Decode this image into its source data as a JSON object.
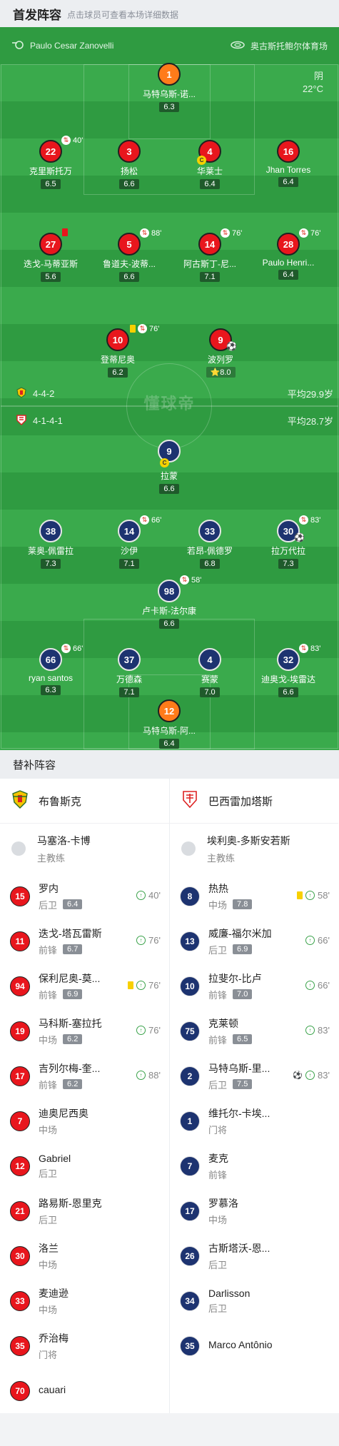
{
  "header": {
    "title": "首发阵容",
    "hint": "点击球员可查看本场详细数据"
  },
  "pitch": {
    "referee": "Paulo Cesar Zanovelli",
    "stadium": "奥古斯托鲍尔体育场",
    "weather": "阴",
    "temperature": "22°C",
    "watermark": "懂球帝",
    "home_formation": "4-4-2",
    "home_avg_age": "平均29.9岁",
    "away_formation": "4-1-4-1",
    "away_avg_age": "平均28.7岁"
  },
  "home_players": [
    {
      "num": "1",
      "name": "马特乌斯-诺...",
      "rating": "6.3"
    },
    {
      "num": "22",
      "name": "克里斯托万",
      "rating": "6.5",
      "sub": "40'"
    },
    {
      "num": "3",
      "name": "扬松",
      "rating": "6.6"
    },
    {
      "num": "4",
      "name": "华莱士",
      "rating": "6.4"
    },
    {
      "num": "16",
      "name": "Jhan Torres",
      "rating": "6.4"
    },
    {
      "num": "27",
      "name": "迭戈-马蒂亚斯",
      "rating": "5.6"
    },
    {
      "num": "5",
      "name": "鲁道夫-波蒂...",
      "rating": "6.6",
      "sub": "88'"
    },
    {
      "num": "14",
      "name": "阿古斯丁-尼...",
      "rating": "7.1",
      "sub": "76'"
    },
    {
      "num": "28",
      "name": "Paulo Henri...",
      "rating": "6.4",
      "sub": "76'"
    },
    {
      "num": "10",
      "name": "登蒂尼奥",
      "rating": "6.2",
      "sub": "76'"
    },
    {
      "num": "9",
      "name": "波列罗",
      "rating": "8.0"
    }
  ],
  "away_players": [
    {
      "num": "9",
      "name": "拉蒙",
      "rating": "6.6"
    },
    {
      "num": "38",
      "name": "莱奥-佩雷拉",
      "rating": "7.3"
    },
    {
      "num": "14",
      "name": "沙伊",
      "rating": "7.1",
      "sub": "66'"
    },
    {
      "num": "33",
      "name": "若昂-佩德罗",
      "rating": "6.8"
    },
    {
      "num": "30",
      "name": "拉万代拉",
      "rating": "7.3",
      "sub": "83'"
    },
    {
      "num": "98",
      "name": "卢卡斯-法尔康",
      "rating": "6.6",
      "sub": "58'"
    },
    {
      "num": "66",
      "name": "ryan santos",
      "rating": "6.3",
      "sub": "66'"
    },
    {
      "num": "37",
      "name": "万德森",
      "rating": "7.1"
    },
    {
      "num": "4",
      "name": "赛蒙",
      "rating": "7.0"
    },
    {
      "num": "32",
      "name": "迪奥戈-埃雷达",
      "rating": "6.6",
      "sub": "83'"
    },
    {
      "num": "12",
      "name": "马特乌斯-阿...",
      "rating": "6.4"
    }
  ],
  "subs": {
    "title": "替补阵容",
    "home": {
      "team": "布鲁斯克",
      "coach": "马塞洛-卡博",
      "coach_role": "主教练",
      "players": [
        {
          "num": "15",
          "name": "罗内",
          "pos": "后卫",
          "rating": "6.4",
          "minute": "40'"
        },
        {
          "num": "11",
          "name": "迭戈-塔瓦雷斯",
          "pos": "前锋",
          "rating": "6.7",
          "minute": "76'"
        },
        {
          "num": "94",
          "name": "保利尼奥-莫...",
          "pos": "前锋",
          "rating": "6.9",
          "minute": "76'"
        },
        {
          "num": "19",
          "name": "马科斯-塞拉托",
          "pos": "中场",
          "rating": "6.2",
          "minute": "76'"
        },
        {
          "num": "17",
          "name": "吉列尔梅-奎...",
          "pos": "前锋",
          "rating": "6.2",
          "minute": "88'"
        },
        {
          "num": "7",
          "name": "迪奥尼西奥",
          "pos": "中场"
        },
        {
          "num": "12",
          "name": "Gabriel",
          "pos": "后卫"
        },
        {
          "num": "21",
          "name": "路易斯-恩里克",
          "pos": "后卫"
        },
        {
          "num": "30",
          "name": "洛兰",
          "pos": "中场"
        },
        {
          "num": "33",
          "name": "麦迪逊",
          "pos": "中场"
        },
        {
          "num": "35",
          "name": "乔治梅",
          "pos": "门将"
        },
        {
          "num": "70",
          "name": "cauari",
          "pos": ""
        }
      ]
    },
    "away": {
      "team": "巴西雷加塔斯",
      "coach": "埃利奥-多斯安若斯",
      "coach_role": "主教练",
      "players": [
        {
          "num": "8",
          "name": "热热",
          "pos": "中场",
          "rating": "7.8",
          "minute": "58'"
        },
        {
          "num": "13",
          "name": "威廉-福尔米加",
          "pos": "后卫",
          "rating": "6.9",
          "minute": "66'"
        },
        {
          "num": "10",
          "name": "拉斐尔-比卢",
          "pos": "前锋",
          "rating": "7.0",
          "minute": "66'"
        },
        {
          "num": "75",
          "name": "克莱顿",
          "pos": "前锋",
          "rating": "6.5",
          "minute": "83'"
        },
        {
          "num": "2",
          "name": "马特乌斯-里...",
          "pos": "后卫",
          "rating": "7.5",
          "minute": "83'"
        },
        {
          "num": "1",
          "name": "维托尔-卡埃...",
          "pos": "门将"
        },
        {
          "num": "7",
          "name": "麦克",
          "pos": "前锋"
        },
        {
          "num": "17",
          "name": "罗慕洛",
          "pos": "中场"
        },
        {
          "num": "26",
          "name": "古斯塔沃-恩...",
          "pos": "后卫"
        },
        {
          "num": "34",
          "name": "Darlisson",
          "pos": "后卫"
        },
        {
          "num": "35",
          "name": "Marco Antônio",
          "pos": ""
        }
      ]
    }
  }
}
